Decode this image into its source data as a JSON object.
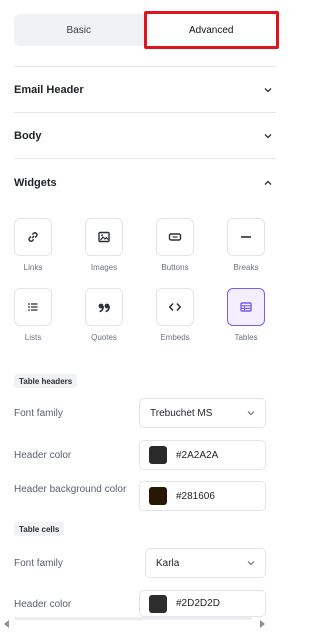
{
  "tabs": [
    {
      "label": "Basic",
      "active": false
    },
    {
      "label": "Advanced",
      "active": true
    }
  ],
  "sections": {
    "email_header": "Email Header",
    "body": "Body",
    "widgets": "Widgets"
  },
  "widgets": [
    {
      "label": "Links",
      "icon": "link-icon"
    },
    {
      "label": "Images",
      "icon": "image-icon"
    },
    {
      "label": "Buttons",
      "icon": "button-icon"
    },
    {
      "label": "Breaks",
      "icon": "break-icon"
    },
    {
      "label": "Lists",
      "icon": "list-icon"
    },
    {
      "label": "Quotes",
      "icon": "quote-icon"
    },
    {
      "label": "Embeds",
      "icon": "embed-icon"
    },
    {
      "label": "Tables",
      "icon": "table-icon",
      "selected": true
    }
  ],
  "table_headers": {
    "title": "Table headers",
    "font_family_label": "Font family",
    "font_family_value": "Trebuchet MS",
    "header_color_label": "Header color",
    "header_color_value": "#2A2A2A",
    "header_color_swatch": "#2a2a2a",
    "header_bg_label": "Header background color",
    "header_bg_value": "#281606",
    "header_bg_swatch": "#281606"
  },
  "table_cells": {
    "title": "Table cells",
    "font_family_label": "Font family",
    "font_family_value": "Karla",
    "header_color_label": "Header color",
    "header_color_value": "#2D2D2D",
    "header_color_swatch": "#2d2d2d"
  },
  "colors": {
    "highlight_border": "#e0141c",
    "selected_accent": "#7b5cf0"
  }
}
